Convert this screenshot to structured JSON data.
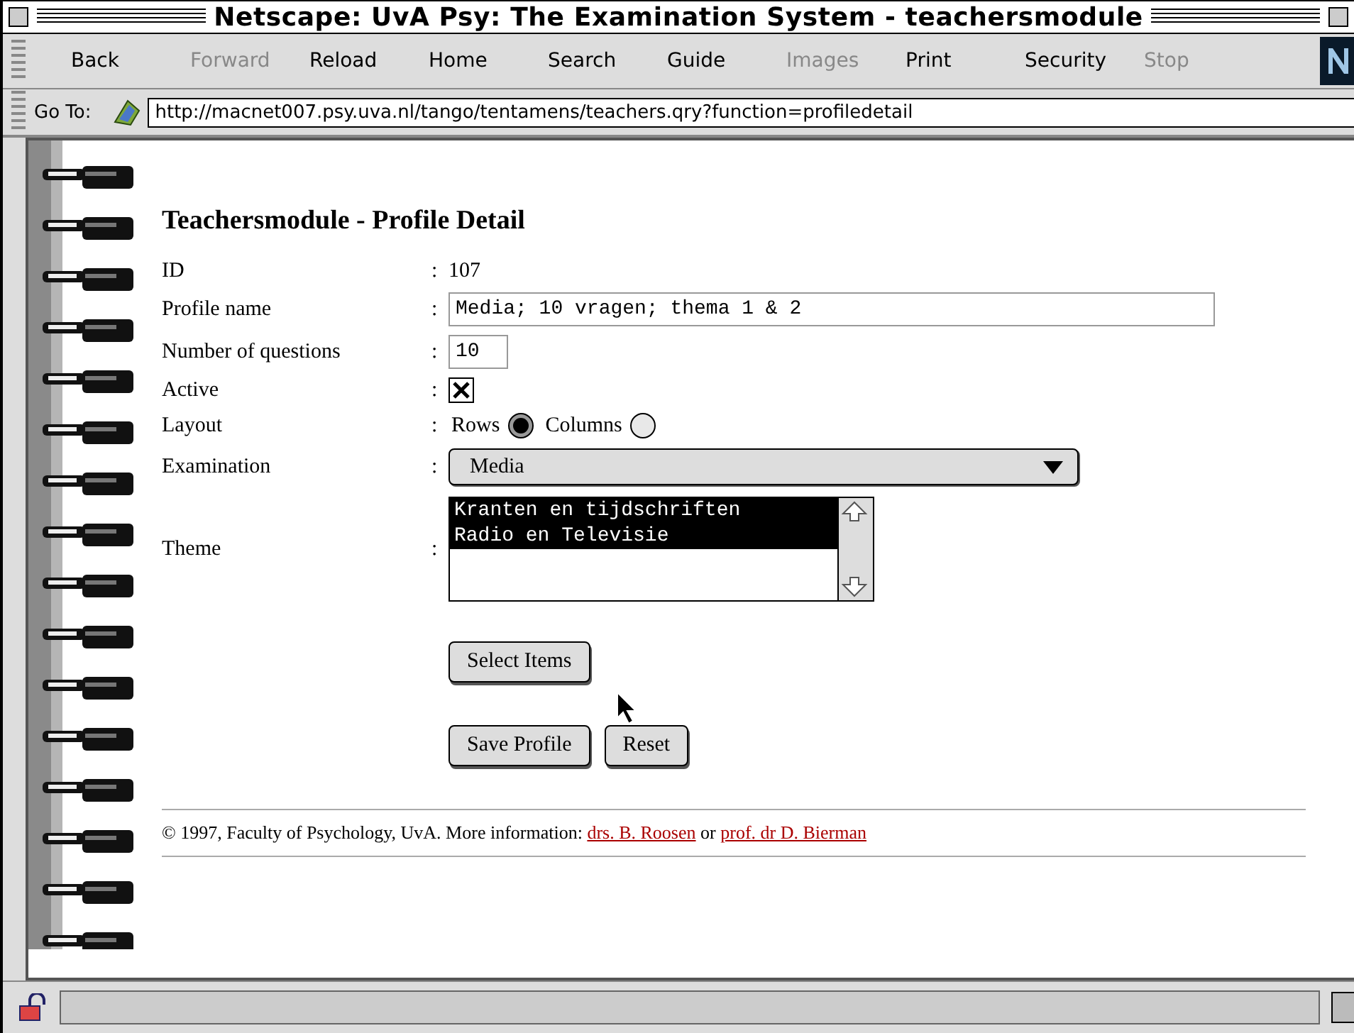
{
  "window": {
    "title": "Netscape: UvA Psy: The Examination System - teachersmodule"
  },
  "toolbar": {
    "buttons": [
      {
        "label": "Back",
        "disabled": false
      },
      {
        "label": "Forward",
        "disabled": true
      },
      {
        "label": "Reload",
        "disabled": false
      },
      {
        "label": "Home",
        "disabled": false
      },
      {
        "label": "Search",
        "disabled": false
      },
      {
        "label": "Guide",
        "disabled": false
      },
      {
        "label": "Images",
        "disabled": true
      },
      {
        "label": "Print",
        "disabled": false
      },
      {
        "label": "Security",
        "disabled": false
      },
      {
        "label": "Stop",
        "disabled": true
      }
    ]
  },
  "location": {
    "label": "Go To:",
    "value": "http://macnet007.psy.uva.nl/tango/tentamens/teachers.qry?function=profiledetail"
  },
  "page": {
    "heading": "Teachersmodule - Profile Detail",
    "fields": [
      {
        "kind": "text",
        "label": "ID",
        "separator": ":",
        "value": "107"
      },
      {
        "kind": "input",
        "label": "Profile name",
        "separator": ":",
        "value": "Media; 10 vragen; thema 1 & 2"
      },
      {
        "kind": "smallinput",
        "label": "Number of questions",
        "separator": ":",
        "value": "10"
      },
      {
        "kind": "checkbox",
        "label": "Active",
        "separator": ":",
        "checked": true
      },
      {
        "kind": "radio",
        "label": "Layout",
        "separator": ":",
        "options": [
          {
            "label": "Rows",
            "selected": true
          },
          {
            "label": "Columns",
            "selected": false
          }
        ]
      },
      {
        "kind": "select",
        "label": "Examination",
        "separator": ":",
        "value": "Media"
      },
      {
        "kind": "listbox",
        "label": "Theme",
        "separator": ":",
        "options": [
          {
            "label": "Kranten en tijdschriften",
            "selected": true
          },
          {
            "label": "Radio en Televisie",
            "selected": true
          }
        ]
      }
    ],
    "button_rows": [
      [
        "Select Items"
      ],
      [
        "Save Profile",
        "Reset"
      ]
    ],
    "footer": {
      "text": "© 1997, Faculty of Psychology, UvA. More information:",
      "links": [
        "drs. B. Roosen",
        "prof. dr D. Bierman"
      ],
      "joiner": "or"
    }
  }
}
